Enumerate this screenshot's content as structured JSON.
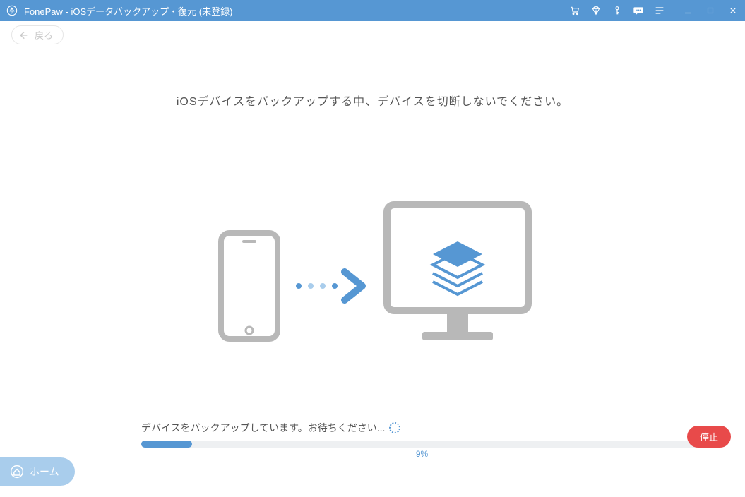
{
  "titlebar": {
    "app_title": "FonePaw - iOSデータバックアップ・復元 (未登録)"
  },
  "toolbar": {
    "back_label": "戻る"
  },
  "main": {
    "instruction": "iOSデバイスをバックアップする中、デバイスを切断しないでください。"
  },
  "progress": {
    "label": "デバイスをバックアップしています。お待ちください...",
    "percent_text": "9%",
    "percent_value": 9
  },
  "buttons": {
    "stop": "停止",
    "home": "ホーム"
  },
  "colors": {
    "primary": "#5697d3",
    "danger": "#e84a4a"
  }
}
